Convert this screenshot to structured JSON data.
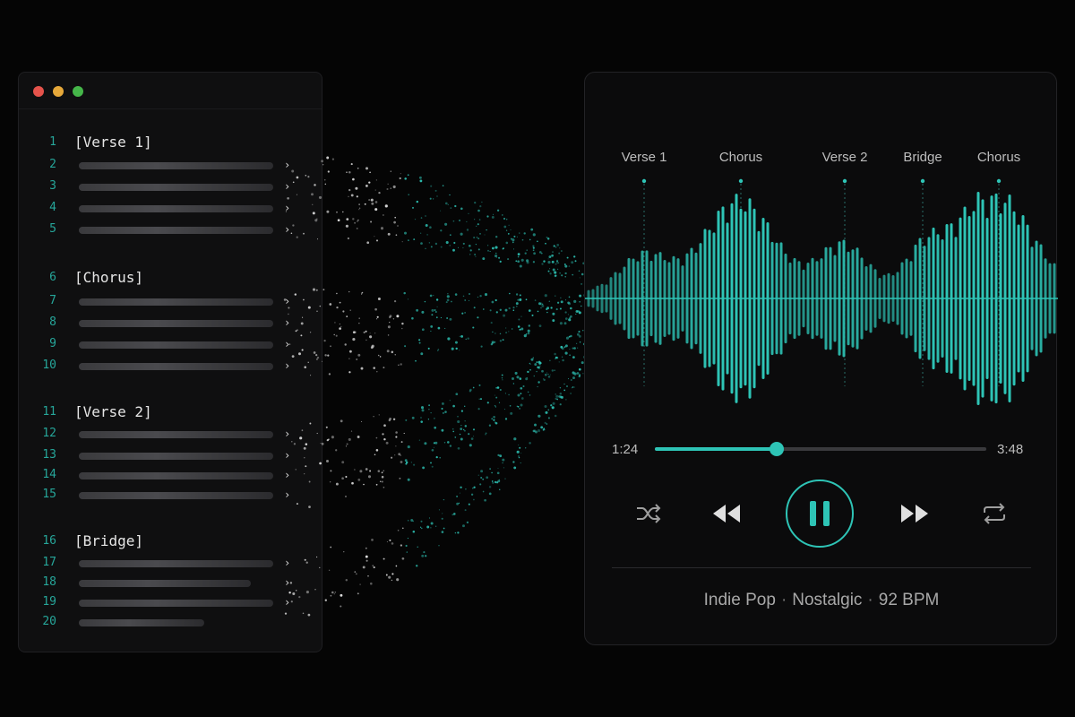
{
  "editor": {
    "window_controls": [
      "close",
      "minimize",
      "maximize"
    ],
    "lines": [
      {
        "num": "1",
        "type": "header",
        "text": "[Verse 1]",
        "y": 0
      },
      {
        "num": "2",
        "type": "bar",
        "w": 0.96
      },
      {
        "num": "3",
        "type": "bar",
        "w": 0.96
      },
      {
        "num": "4",
        "type": "bar",
        "w": 0.96
      },
      {
        "num": "5",
        "type": "bar",
        "w": 0.96
      },
      {
        "num": "6",
        "type": "header",
        "text": "[Chorus]"
      },
      {
        "num": "7",
        "type": "bar",
        "w": 0.96
      },
      {
        "num": "8",
        "type": "bar",
        "w": 0.96
      },
      {
        "num": "9",
        "type": "bar",
        "w": 0.96
      },
      {
        "num": "10",
        "type": "bar",
        "w": 0.96
      },
      {
        "num": "11",
        "type": "header",
        "text": "[Verse 2]"
      },
      {
        "num": "12",
        "type": "bar",
        "w": 0.96
      },
      {
        "num": "13",
        "type": "bar",
        "w": 0.96
      },
      {
        "num": "14",
        "type": "bar",
        "w": 0.96
      },
      {
        "num": "15",
        "type": "bar",
        "w": 0.96
      },
      {
        "num": "16",
        "type": "header",
        "text": "[Bridge]"
      },
      {
        "num": "17",
        "type": "bar",
        "w": 0.96
      },
      {
        "num": "18",
        "type": "bar",
        "w": 0.85
      },
      {
        "num": "19",
        "type": "bar",
        "w": 0.96
      },
      {
        "num": "20",
        "type": "bar",
        "w": 0.62
      }
    ]
  },
  "player": {
    "sections": [
      "Verse 1",
      "Chorus",
      "Verse 2",
      "Bridge",
      "Chorus"
    ],
    "elapsed": "1:24",
    "duration": "3:48",
    "progress": 0.368,
    "controls": [
      "shuffle-icon",
      "rewind-icon",
      "pause-icon",
      "fast-forward-icon",
      "repeat-icon"
    ],
    "genre": "Indie Pop",
    "mood": "Nostalgic",
    "tempo": "92 BPM",
    "accent_color": "#2ec4b6"
  }
}
